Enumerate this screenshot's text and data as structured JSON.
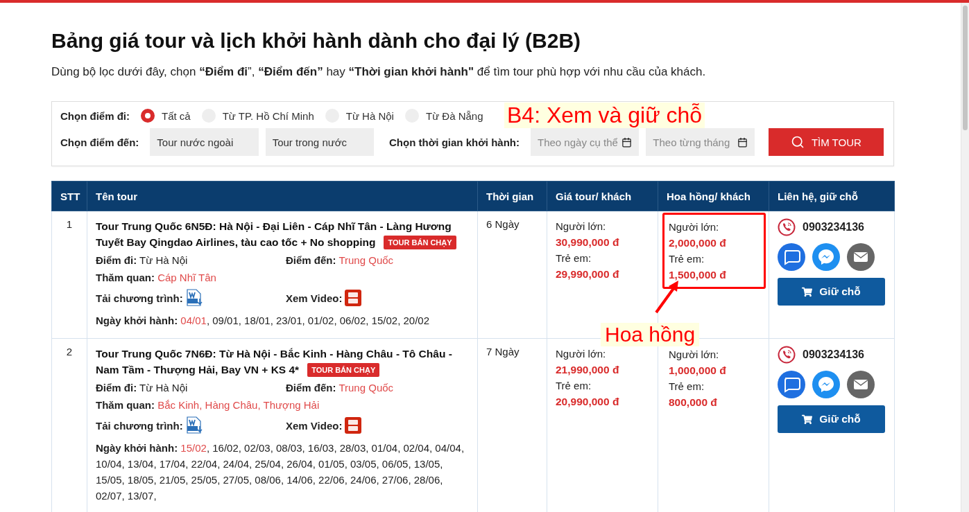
{
  "page": {
    "title": "Bảng giá tour và lịch khởi hành dành cho đại lý (B2B)",
    "intro": "Dùng bộ lọc dưới đây, chọn **“Điểm đi**”, **“Điểm đến”** hay **“Thời gian khởi hành\"**  để tìm tour phù hợp với nhu cầu của khách."
  },
  "filters": {
    "origin_label": "Chọn điểm đi:",
    "origin_options": [
      {
        "label": "Tất cả",
        "selected": true
      },
      {
        "label": "Từ TP. Hồ Chí Minh",
        "selected": false
      },
      {
        "label": "Từ Hà Nội",
        "selected": false
      },
      {
        "label": "Từ Đà Nẵng",
        "selected": false
      }
    ],
    "destination_label": "Chọn điểm đến:",
    "destination_fields": [
      {
        "value": "Tour nước ngoài"
      },
      {
        "value": "Tour trong nước"
      }
    ],
    "time_label": "Chọn thời gian khởi hành:",
    "date_fields": [
      {
        "placeholder": "Theo ngày cụ thể"
      },
      {
        "placeholder": "Theo từng tháng"
      }
    ],
    "search_button": "TÌM TOUR",
    "step_note": "B4: Xem và giữ chỗ"
  },
  "table": {
    "columns": [
      "STT",
      "Tên tour",
      "Thời gian",
      "Giá tour/ khách",
      "Hoa hồng/ khách",
      "Liên hệ, giữ chỗ"
    ],
    "rows": [
      {
        "stt": "1",
        "title": "Tour Trung Quốc 6N5Đ: Hà Nội - Đại Liên - Cáp Nhĩ Tân - Làng Hương Tuyết Bay Qingdao Airlines, tàu cao tốc + No shopping",
        "badge": "TOUR BÁN CHẠY",
        "origin_label": "Điểm đi:",
        "origin": "Từ Hà Nội",
        "dest_label": "Điểm đến:",
        "dest": "Trung Quốc",
        "sight_label": "Thăm quan:",
        "sight": "Cáp Nhĩ Tân",
        "download_label": "Tải chương trình:",
        "video_label": "Xem Video:",
        "dates_label": "Ngày khởi hành:",
        "dates": [
          {
            "text": "04/01",
            "highlighted": true
          },
          {
            "text": ", 09/01, 18/01, 23/01, 01/02, 06/02, 15/02, 20/02",
            "highlighted": false
          }
        ],
        "duration": "6 Ngày",
        "price": {
          "adult_label": "Người lớn:",
          "adult": "30,990,000 đ",
          "child_label": "Trẻ em:",
          "child": "29,990,000 đ"
        },
        "commission": {
          "adult_label": "Người lớn:",
          "adult": "2,000,000 đ",
          "child_label": "Trẻ em:",
          "child": "1,500,000 đ",
          "highlighted": true,
          "callout": "Hoa hồng"
        },
        "phone": "0903234136",
        "reserve": "Giữ chỗ"
      },
      {
        "stt": "2",
        "title": "Tour Trung Quốc 7N6Đ: Từ Hà Nội - Bắc Kinh - Hàng Châu - Tô Châu - Nam Tầm - Thượng Hải, Bay VN + KS 4*",
        "badge": "TOUR BÁN CHẠY",
        "origin_label": "Điểm đi:",
        "origin": "Từ Hà Nội",
        "dest_label": "Điểm đến:",
        "dest": "Trung Quốc",
        "sight_label": "Thăm quan:",
        "sight": "Bắc Kinh, Hàng Châu, Thượng Hải",
        "download_label": "Tải chương trình:",
        "video_label": "Xem Video:",
        "dates_label": "Ngày khởi hành:",
        "dates": [
          {
            "text": "15/02",
            "highlighted": true
          },
          {
            "text": ", 16/02, 02/03, 08/03, 16/03, 28/03, 01/04, 02/04, 04/04, 10/04, 13/04, 17/04, 22/04, 24/04, 25/04, 26/04, 01/05, 03/05, 06/05, 13/05, 15/05, 18/05, 21/05, 25/05, 27/05, 08/06, 14/06, 22/06, 24/06, 27/06, 28/06, 02/07, 13/07,",
            "highlighted": false
          }
        ],
        "duration": "7 Ngày",
        "price": {
          "adult_label": "Người lớn:",
          "adult": "21,990,000 đ",
          "child_label": "Trẻ em:",
          "child": "20,990,000 đ"
        },
        "commission": {
          "adult_label": "Người lớn:",
          "adult": "1,000,000 đ",
          "child_label": "Trẻ em:",
          "child": "800,000 đ",
          "highlighted": false
        },
        "phone": "0903234136",
        "reserve": "Giữ chỗ"
      }
    ]
  }
}
